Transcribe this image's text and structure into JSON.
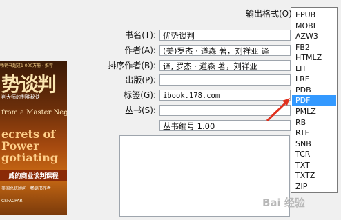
{
  "cover": {
    "line1": "畅销书超过1 000万册 · 推荐",
    "title_big": "势谈判",
    "line3": "判大师的制胜秘诀",
    "en_small": "from a Master Negotiator",
    "en_big_1": "ecrets of",
    "en_big_2": "Power",
    "en_big_3": "gotiating",
    "cn_banner": "威的商业谈判课程",
    "line7": "美国总统顾问 · 畅销书作者",
    "line8": "CSFACPAR"
  },
  "form": {
    "title_label": "书名(T):",
    "title_value": "优势谈判",
    "author_label": "作者(A):",
    "author_value": "(美)罗杰 · 道森 著，刘祥亚 译",
    "sort_author_label": "排序作者(B):",
    "sort_author_value": "译, 罗杰 · 道森 著，刘祥亚",
    "publisher_label": "出版(P):",
    "publisher_value": "",
    "tags_label": "标签(G):",
    "tags_value": "ibook.178.com",
    "series_label": "丛书(S):",
    "series_value": "",
    "series_number_value": "丛书编号 1.00"
  },
  "output": {
    "label": "输出格式(O):",
    "formats": [
      "EPUB",
      "MOBI",
      "AZW3",
      "FB2",
      "HTMLZ",
      "LIT",
      "LRF",
      "PDB",
      "PDF",
      "PMLZ",
      "RB",
      "RTF",
      "SNB",
      "TCR",
      "TXT",
      "TXTZ",
      "ZIP"
    ],
    "selected": "PDF"
  },
  "colors": {
    "selection": "#3399ff",
    "arrow": "#e0301e"
  },
  "watermark": "Bai 经验"
}
